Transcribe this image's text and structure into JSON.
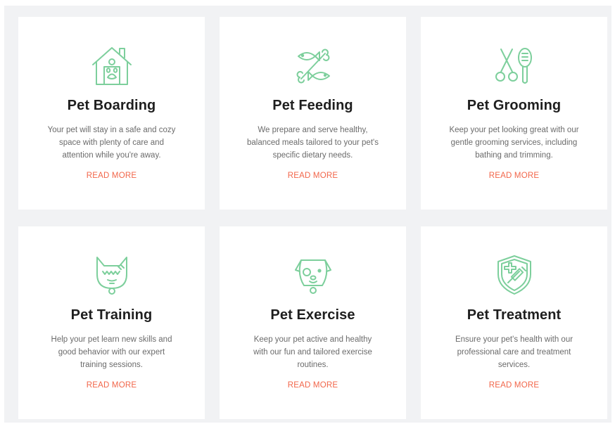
{
  "colors": {
    "background": "#f1f2f4",
    "card": "#ffffff",
    "icon": "#7dcf9c",
    "title": "#1e1e1e",
    "text": "#6b6b6b",
    "link": "#f2664a"
  },
  "cards": [
    {
      "icon": "house-paw-icon",
      "title": "Pet Boarding",
      "description": "Your pet will stay in a safe and cozy space with plenty of care and attention while you're away.",
      "link": "READ MORE"
    },
    {
      "icon": "fish-bone-icon",
      "title": "Pet Feeding",
      "description": "We prepare and serve healthy, balanced meals tailored to your pet's specific dietary needs.",
      "link": "READ MORE"
    },
    {
      "icon": "scissors-brush-icon",
      "title": "Pet Grooming",
      "description": "Keep your pet looking great with our gentle grooming services, including bathing and trimming.",
      "link": "READ MORE"
    },
    {
      "icon": "cat-face-icon",
      "title": "Pet Training",
      "description": "Help your pet learn new skills and good behavior with our expert training sessions.",
      "link": "READ MORE"
    },
    {
      "icon": "dog-face-icon",
      "title": "Pet Exercise",
      "description": "Keep your pet active and healthy with our fun and tailored exercise routines.",
      "link": "READ MORE"
    },
    {
      "icon": "shield-syringe-icon",
      "title": "Pet Treatment",
      "description": "Ensure your pet's health with our professional care and treatment services.",
      "link": "READ MORE"
    }
  ]
}
